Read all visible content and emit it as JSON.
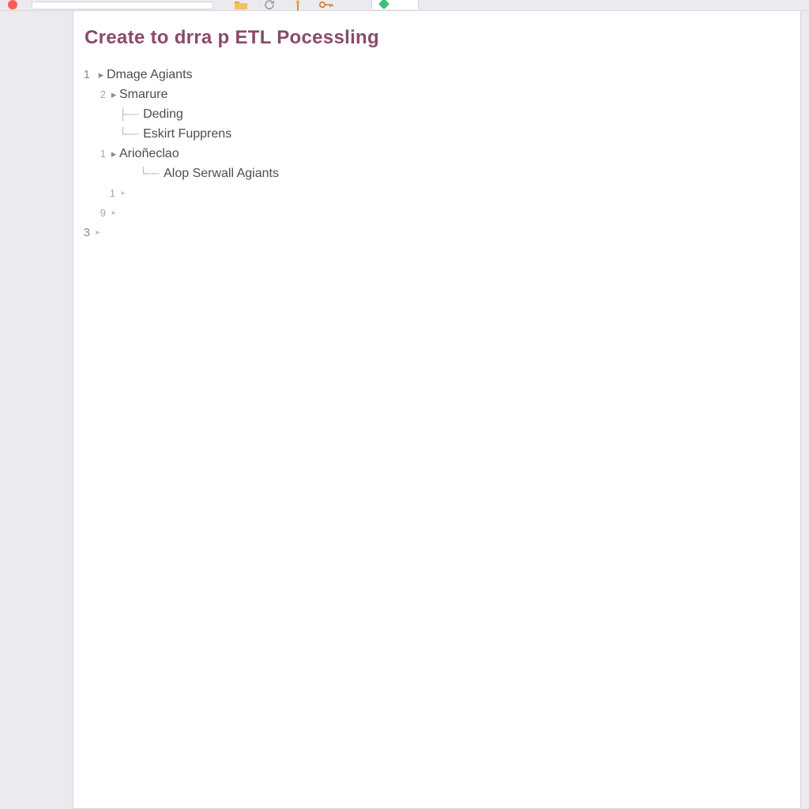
{
  "colors": {
    "title": "#8a4a6a",
    "text": "#4e4b54",
    "canvas": "#ffffff",
    "app_bg": "#eceaee"
  },
  "toolbar": {
    "address_value": "",
    "icons": [
      "folder-icon",
      "refresh-icon",
      "pin-icon",
      "key-icon"
    ]
  },
  "tab": {
    "label": ""
  },
  "document": {
    "title": "Create to  drra p  ETL Pocessling",
    "outline": [
      {
        "line": "1",
        "depth": 0,
        "marker": "twisty",
        "label": "Dmage Agiants"
      },
      {
        "line": "2",
        "depth": 1,
        "marker": "twisty",
        "label": "Smarure"
      },
      {
        "line": "",
        "depth": 2,
        "marker": "branch-mid",
        "label": "Deding"
      },
      {
        "line": "",
        "depth": 2,
        "marker": "branch-end",
        "label": "Eskirt Fupprens"
      },
      {
        "line": "1",
        "depth": 1,
        "marker": "twisty",
        "label": "Arioñeclao"
      },
      {
        "line": "",
        "depth": 2,
        "marker": "branch-end",
        "label": "Alop Serwall Agiants"
      },
      {
        "line": "1",
        "depth": 1,
        "marker": "num-only",
        "label": ""
      },
      {
        "line": "9",
        "depth": 1,
        "marker": "num-only",
        "label": ""
      },
      {
        "line": "3",
        "depth": 0,
        "marker": "num-only",
        "label": ""
      }
    ]
  }
}
